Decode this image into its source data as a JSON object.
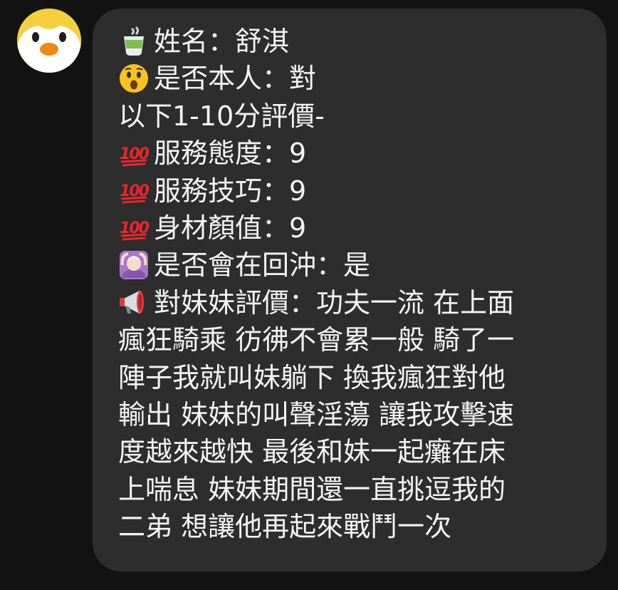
{
  "message": {
    "lines": [
      {
        "icon": "teacup-icon",
        "text": "姓名：舒淇"
      },
      {
        "icon": "astonished-face-icon",
        "text": "是否本人：對"
      },
      {
        "icon": "",
        "text": "以下1-10分評價-"
      },
      {
        "icon": "hundred-points-icon",
        "text": "服務態度：9"
      },
      {
        "icon": "hundred-points-icon",
        "text": "服務技巧：9"
      },
      {
        "icon": "hundred-points-icon",
        "text": "身材顏值：9"
      },
      {
        "icon": "person-ok-gesture-icon",
        "text": "是否會在回沖：是"
      },
      {
        "icon": "megaphone-icon",
        "text": "對妹妹評價：功夫一流 在上面"
      },
      {
        "icon": "",
        "text": "瘋狂騎乘 彷彿不會累一般 騎了一"
      },
      {
        "icon": "",
        "text": "陣子我就叫妹躺下 換我瘋狂對他"
      },
      {
        "icon": "",
        "text": "輸出 妹妹的叫聲淫蕩 讓我攻擊速"
      },
      {
        "icon": "",
        "text": "度越來越快 最後和妹一起癱在床"
      },
      {
        "icon": "",
        "text": "上喘息 妹妹期間還一直挑逗我的"
      },
      {
        "icon": "",
        "text": "二弟 想讓他再起來戰鬥一次"
      }
    ]
  },
  "avatar": {
    "icon": "penguin-avatar-icon"
  },
  "colors": {
    "background": "#121212",
    "bubble": "#2d2d2d",
    "text": "#f4f4f4",
    "avatar_bg": "#f6cf3f"
  }
}
